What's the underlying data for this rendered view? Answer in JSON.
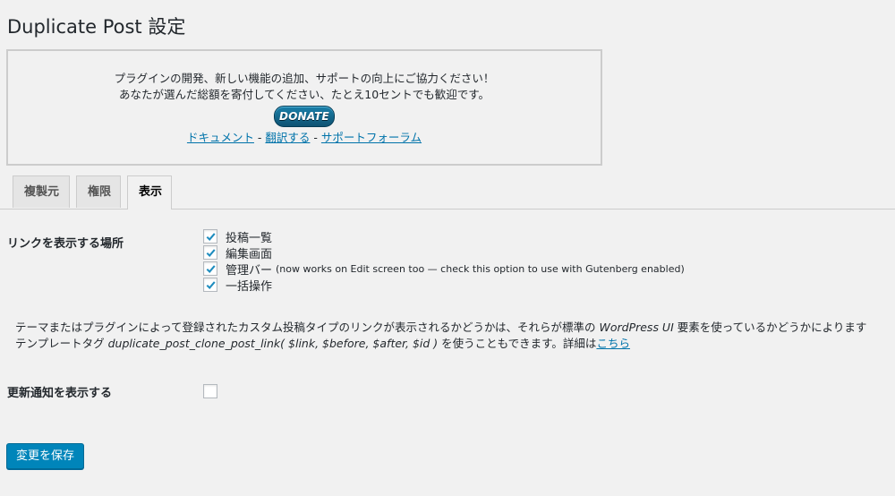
{
  "page": {
    "title": "Duplicate Post 設定"
  },
  "donate": {
    "line1": "プラグインの開発、新しい機能の追加、サポートの向上にご協力ください！",
    "line2": "あなたが選んだ総額を寄付してください、たとえ10セントでも歓迎です。",
    "button_label": "DONATE",
    "links": [
      {
        "label": "ドキュメント"
      },
      {
        "label": "翻訳する"
      },
      {
        "label": "サポートフォーラム"
      }
    ],
    "separator": " - "
  },
  "tabs": [
    {
      "label": "複製元",
      "active": false
    },
    {
      "label": "権限",
      "active": false
    },
    {
      "label": "表示",
      "active": true
    }
  ],
  "show_links": {
    "label": "リンクを表示する場所",
    "options": [
      {
        "label": "投稿一覧",
        "checked": true,
        "note": ""
      },
      {
        "label": "編集画面",
        "checked": true,
        "note": ""
      },
      {
        "label": "管理バー",
        "checked": true,
        "note": "(now works on Edit screen too — check this option to use with Gutenberg enabled)"
      },
      {
        "label": "一括操作",
        "checked": true,
        "note": ""
      }
    ]
  },
  "description": {
    "line1_pre": "テーマまたはプラグインによって登録されたカスタム投稿タイプのリンクが表示されるかどうかは、それらが標準の ",
    "line1_em": "WordPress UI",
    "line1_post": " 要素を使っているかどうかによります",
    "line2_pre": "テンプレートタグ ",
    "line2_em": "duplicate_post_clone_post_link( $link, $before, $after, $id )",
    "line2_mid": " を使うこともできます。詳細は",
    "line2_link": "こちら"
  },
  "update_notice": {
    "label": "更新通知を表示する",
    "checked": false
  },
  "save_button": {
    "label": "変更を保存"
  },
  "colors": {
    "link": "#0073aa",
    "primary_button": "#0085ba",
    "check": "#1e8cbe"
  }
}
